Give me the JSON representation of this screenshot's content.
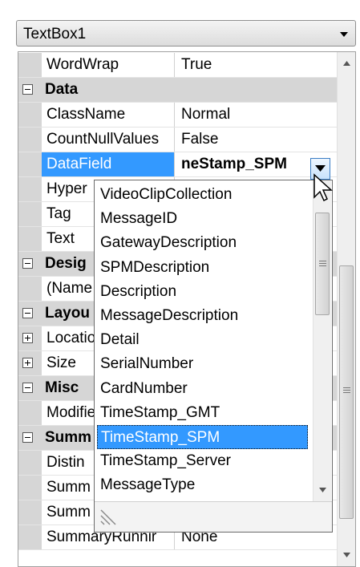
{
  "selector": {
    "value": "TextBox1",
    "icon": "chevron-down-icon"
  },
  "properties": [
    {
      "kind": "prop",
      "name": "WordWrap",
      "value": "True"
    },
    {
      "kind": "cat",
      "name": "Data",
      "toggle": "minus"
    },
    {
      "kind": "prop",
      "name": "ClassName",
      "value": "Normal"
    },
    {
      "kind": "prop",
      "name": "CountNullValues",
      "value": "False"
    },
    {
      "kind": "prop",
      "name": "DataField",
      "value": "neStamp_SPM",
      "selected": true
    },
    {
      "kind": "prop",
      "name": "Hyper",
      "value": ""
    },
    {
      "kind": "prop",
      "name": "Tag",
      "value": ""
    },
    {
      "kind": "prop",
      "name": "Text",
      "value": ""
    },
    {
      "kind": "cat",
      "name": "Desig",
      "toggle": "minus"
    },
    {
      "kind": "prop",
      "name": "(Name",
      "value": ""
    },
    {
      "kind": "cat",
      "name": "Layou",
      "toggle": "minus"
    },
    {
      "kind": "sub",
      "name": "Locatio",
      "value": "",
      "toggle": "plus"
    },
    {
      "kind": "sub",
      "name": "Size",
      "value": "",
      "toggle": "plus"
    },
    {
      "kind": "cat",
      "name": "Misc",
      "toggle": "minus"
    },
    {
      "kind": "prop",
      "name": "Modifie",
      "value": ""
    },
    {
      "kind": "cat",
      "name": "Summ",
      "toggle": "minus"
    },
    {
      "kind": "prop",
      "name": "Distin",
      "value": ""
    },
    {
      "kind": "prop",
      "name": "Summ",
      "value": ""
    },
    {
      "kind": "prop",
      "name": "Summ",
      "value": ""
    },
    {
      "kind": "prop",
      "name": "SummaryRunnir",
      "value": "None"
    }
  ],
  "dropdown": {
    "options": [
      "VideoClipCollection",
      "MessageID",
      "GatewayDescription",
      "SPMDescription",
      "Description",
      "MessageDescription",
      "Detail",
      "SerialNumber",
      "CardNumber",
      "TimeStamp_GMT",
      "TimeStamp_SPM",
      "TimeStamp_Server",
      "MessageType"
    ],
    "selected": "TimeStamp_SPM",
    "button_icon": "dropdown-arrow-icon",
    "grip_icon": "resize-grip-icon"
  },
  "colors": {
    "selection": "#3399ff",
    "category_bg": "#d6d6d6",
    "border": "#a0a0a0"
  }
}
